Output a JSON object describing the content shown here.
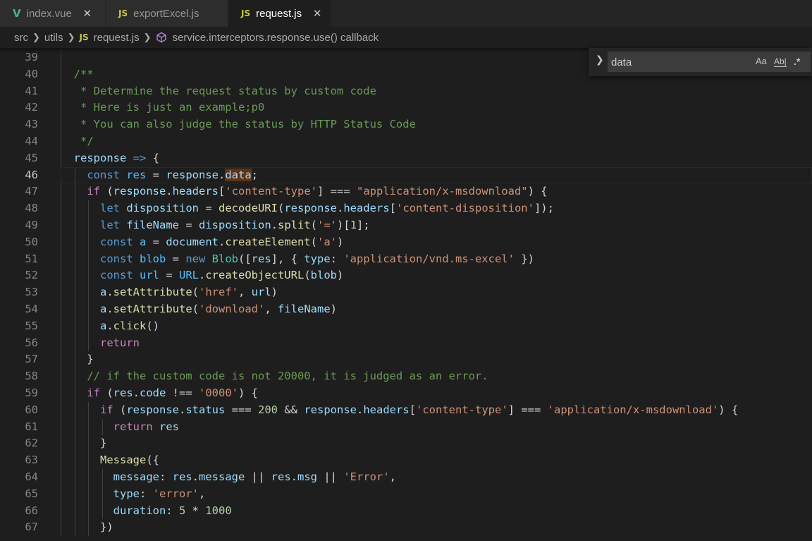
{
  "tabs": [
    {
      "label": "index.vue",
      "icon": "V",
      "type": "vue",
      "active": false,
      "closable": true
    },
    {
      "label": "exportExcel.js",
      "icon": "JS",
      "type": "js",
      "active": false,
      "closable": false
    },
    {
      "label": "request.js",
      "icon": "JS",
      "type": "js",
      "active": true,
      "closable": true
    }
  ],
  "breadcrumb": {
    "folder1": "src",
    "folder2": "utils",
    "file_icon": "JS",
    "file": "request.js",
    "symbol": "service.interceptors.response.use() callback"
  },
  "find": {
    "query": "data",
    "match_case": "Aa",
    "whole_word": "Ab|",
    "regex": ".*"
  },
  "current_line": 46,
  "lines": [
    {
      "n": "39",
      "tokens": []
    },
    {
      "n": "40",
      "tokens": [
        [
          "c",
          "  /**"
        ]
      ]
    },
    {
      "n": "41",
      "tokens": [
        [
          "c",
          "   * Determine the request status by custom code"
        ]
      ]
    },
    {
      "n": "42",
      "tokens": [
        [
          "c",
          "   * Here is just an example;p0"
        ]
      ]
    },
    {
      "n": "43",
      "tokens": [
        [
          "c",
          "   * You can also judge the status by HTTP Status Code"
        ]
      ]
    },
    {
      "n": "44",
      "tokens": [
        [
          "c",
          "   */"
        ]
      ]
    },
    {
      "n": "45",
      "tokens": [
        [
          "v",
          "  response"
        ],
        [
          "k",
          " =>"
        ],
        [
          "p",
          " {"
        ]
      ]
    },
    {
      "n": "46",
      "tokens": [
        [
          "k",
          "    const"
        ],
        [
          "cv",
          " res"
        ],
        [
          "p",
          " = "
        ],
        [
          "v",
          "response"
        ],
        [
          "p",
          "."
        ],
        [
          "vm",
          "data"
        ],
        [
          "p",
          ";"
        ]
      ]
    },
    {
      "n": "47",
      "tokens": [
        [
          "ctl",
          "    if"
        ],
        [
          "p",
          " ("
        ],
        [
          "v",
          "response"
        ],
        [
          "p",
          "."
        ],
        [
          "v",
          "headers"
        ],
        [
          "p",
          "["
        ],
        [
          "s",
          "'content-type'"
        ],
        [
          "p",
          "] === "
        ],
        [
          "s",
          "\"application/x-msdownload\""
        ],
        [
          "p",
          ") {"
        ]
      ]
    },
    {
      "n": "48",
      "tokens": [
        [
          "k",
          "      let"
        ],
        [
          "v",
          " disposition"
        ],
        [
          "p",
          " = "
        ],
        [
          "f",
          "decodeURI"
        ],
        [
          "p",
          "("
        ],
        [
          "v",
          "response"
        ],
        [
          "p",
          "."
        ],
        [
          "v",
          "headers"
        ],
        [
          "p",
          "["
        ],
        [
          "s",
          "'content-disposition'"
        ],
        [
          "p",
          "]);"
        ]
      ]
    },
    {
      "n": "49",
      "tokens": [
        [
          "k",
          "      let"
        ],
        [
          "v",
          " fileName"
        ],
        [
          "p",
          " = "
        ],
        [
          "v",
          "disposition"
        ],
        [
          "p",
          "."
        ],
        [
          "f",
          "split"
        ],
        [
          "p",
          "("
        ],
        [
          "s",
          "'='"
        ],
        [
          "p",
          ")["
        ],
        [
          "n",
          "1"
        ],
        [
          "p",
          "];"
        ]
      ]
    },
    {
      "n": "50",
      "tokens": [
        [
          "k",
          "      const"
        ],
        [
          "cv",
          " a"
        ],
        [
          "p",
          " = "
        ],
        [
          "v",
          "document"
        ],
        [
          "p",
          "."
        ],
        [
          "f",
          "createElement"
        ],
        [
          "p",
          "("
        ],
        [
          "s",
          "'a'"
        ],
        [
          "p",
          ")"
        ]
      ]
    },
    {
      "n": "51",
      "tokens": [
        [
          "k",
          "      const"
        ],
        [
          "cv",
          " blob"
        ],
        [
          "p",
          " = "
        ],
        [
          "k",
          "new"
        ],
        [
          "t",
          " Blob"
        ],
        [
          "p",
          "(["
        ],
        [
          "v",
          "res"
        ],
        [
          "p",
          "], { "
        ],
        [
          "v",
          "type"
        ],
        [
          "p",
          ": "
        ],
        [
          "s",
          "'application/vnd.ms-excel'"
        ],
        [
          "p",
          " })"
        ]
      ]
    },
    {
      "n": "52",
      "tokens": [
        [
          "k",
          "      const"
        ],
        [
          "cv",
          " url"
        ],
        [
          "p",
          " = "
        ],
        [
          "cv",
          "URL"
        ],
        [
          "p",
          "."
        ],
        [
          "f",
          "createObjectURL"
        ],
        [
          "p",
          "("
        ],
        [
          "v",
          "blob"
        ],
        [
          "p",
          ")"
        ]
      ]
    },
    {
      "n": "53",
      "tokens": [
        [
          "v",
          "      a"
        ],
        [
          "p",
          "."
        ],
        [
          "f",
          "setAttribute"
        ],
        [
          "p",
          "("
        ],
        [
          "s",
          "'href'"
        ],
        [
          "p",
          ", "
        ],
        [
          "v",
          "url"
        ],
        [
          "p",
          ")"
        ]
      ]
    },
    {
      "n": "54",
      "tokens": [
        [
          "v",
          "      a"
        ],
        [
          "p",
          "."
        ],
        [
          "f",
          "setAttribute"
        ],
        [
          "p",
          "("
        ],
        [
          "s",
          "'download'"
        ],
        [
          "p",
          ", "
        ],
        [
          "v",
          "fileName"
        ],
        [
          "p",
          ")"
        ]
      ]
    },
    {
      "n": "55",
      "tokens": [
        [
          "v",
          "      a"
        ],
        [
          "p",
          "."
        ],
        [
          "f",
          "click"
        ],
        [
          "p",
          "()"
        ]
      ]
    },
    {
      "n": "56",
      "tokens": [
        [
          "ctl",
          "      return"
        ]
      ]
    },
    {
      "n": "57",
      "tokens": [
        [
          "p",
          "    }"
        ]
      ]
    },
    {
      "n": "58",
      "tokens": [
        [
          "c",
          "    // if the custom code is not 20000, it is judged as an error."
        ]
      ]
    },
    {
      "n": "59",
      "tokens": [
        [
          "ctl",
          "    if"
        ],
        [
          "p",
          " ("
        ],
        [
          "v",
          "res"
        ],
        [
          "p",
          "."
        ],
        [
          "v",
          "code"
        ],
        [
          "p",
          " !== "
        ],
        [
          "s",
          "'0000'"
        ],
        [
          "p",
          ") {"
        ]
      ]
    },
    {
      "n": "60",
      "tokens": [
        [
          "ctl",
          "      if"
        ],
        [
          "p",
          " ("
        ],
        [
          "v",
          "response"
        ],
        [
          "p",
          "."
        ],
        [
          "v",
          "status"
        ],
        [
          "p",
          " === "
        ],
        [
          "n",
          "200"
        ],
        [
          "p",
          " && "
        ],
        [
          "v",
          "response"
        ],
        [
          "p",
          "."
        ],
        [
          "v",
          "headers"
        ],
        [
          "p",
          "["
        ],
        [
          "s",
          "'content-type'"
        ],
        [
          "p",
          "] === "
        ],
        [
          "s",
          "'application/x-msdownload'"
        ],
        [
          "p",
          ") {"
        ]
      ]
    },
    {
      "n": "61",
      "tokens": [
        [
          "ctl",
          "        return"
        ],
        [
          "v",
          " res"
        ]
      ]
    },
    {
      "n": "62",
      "tokens": [
        [
          "p",
          "      }"
        ]
      ]
    },
    {
      "n": "63",
      "tokens": [
        [
          "f",
          "      Message"
        ],
        [
          "p",
          "({"
        ]
      ]
    },
    {
      "n": "64",
      "tokens": [
        [
          "v",
          "        message"
        ],
        [
          "p",
          ": "
        ],
        [
          "v",
          "res"
        ],
        [
          "p",
          "."
        ],
        [
          "v",
          "message"
        ],
        [
          "p",
          " || "
        ],
        [
          "v",
          "res"
        ],
        [
          "p",
          "."
        ],
        [
          "v",
          "msg"
        ],
        [
          "p",
          " || "
        ],
        [
          "s",
          "'Error'"
        ],
        [
          "p",
          ","
        ]
      ]
    },
    {
      "n": "65",
      "tokens": [
        [
          "v",
          "        type"
        ],
        [
          "p",
          ": "
        ],
        [
          "s",
          "'error'"
        ],
        [
          "p",
          ","
        ]
      ]
    },
    {
      "n": "66",
      "tokens": [
        [
          "v",
          "        duration"
        ],
        [
          "p",
          ": "
        ],
        [
          "n",
          "5"
        ],
        [
          "p",
          " * "
        ],
        [
          "n",
          "1000"
        ]
      ]
    },
    {
      "n": "67",
      "tokens": [
        [
          "p",
          "      })"
        ]
      ]
    }
  ]
}
